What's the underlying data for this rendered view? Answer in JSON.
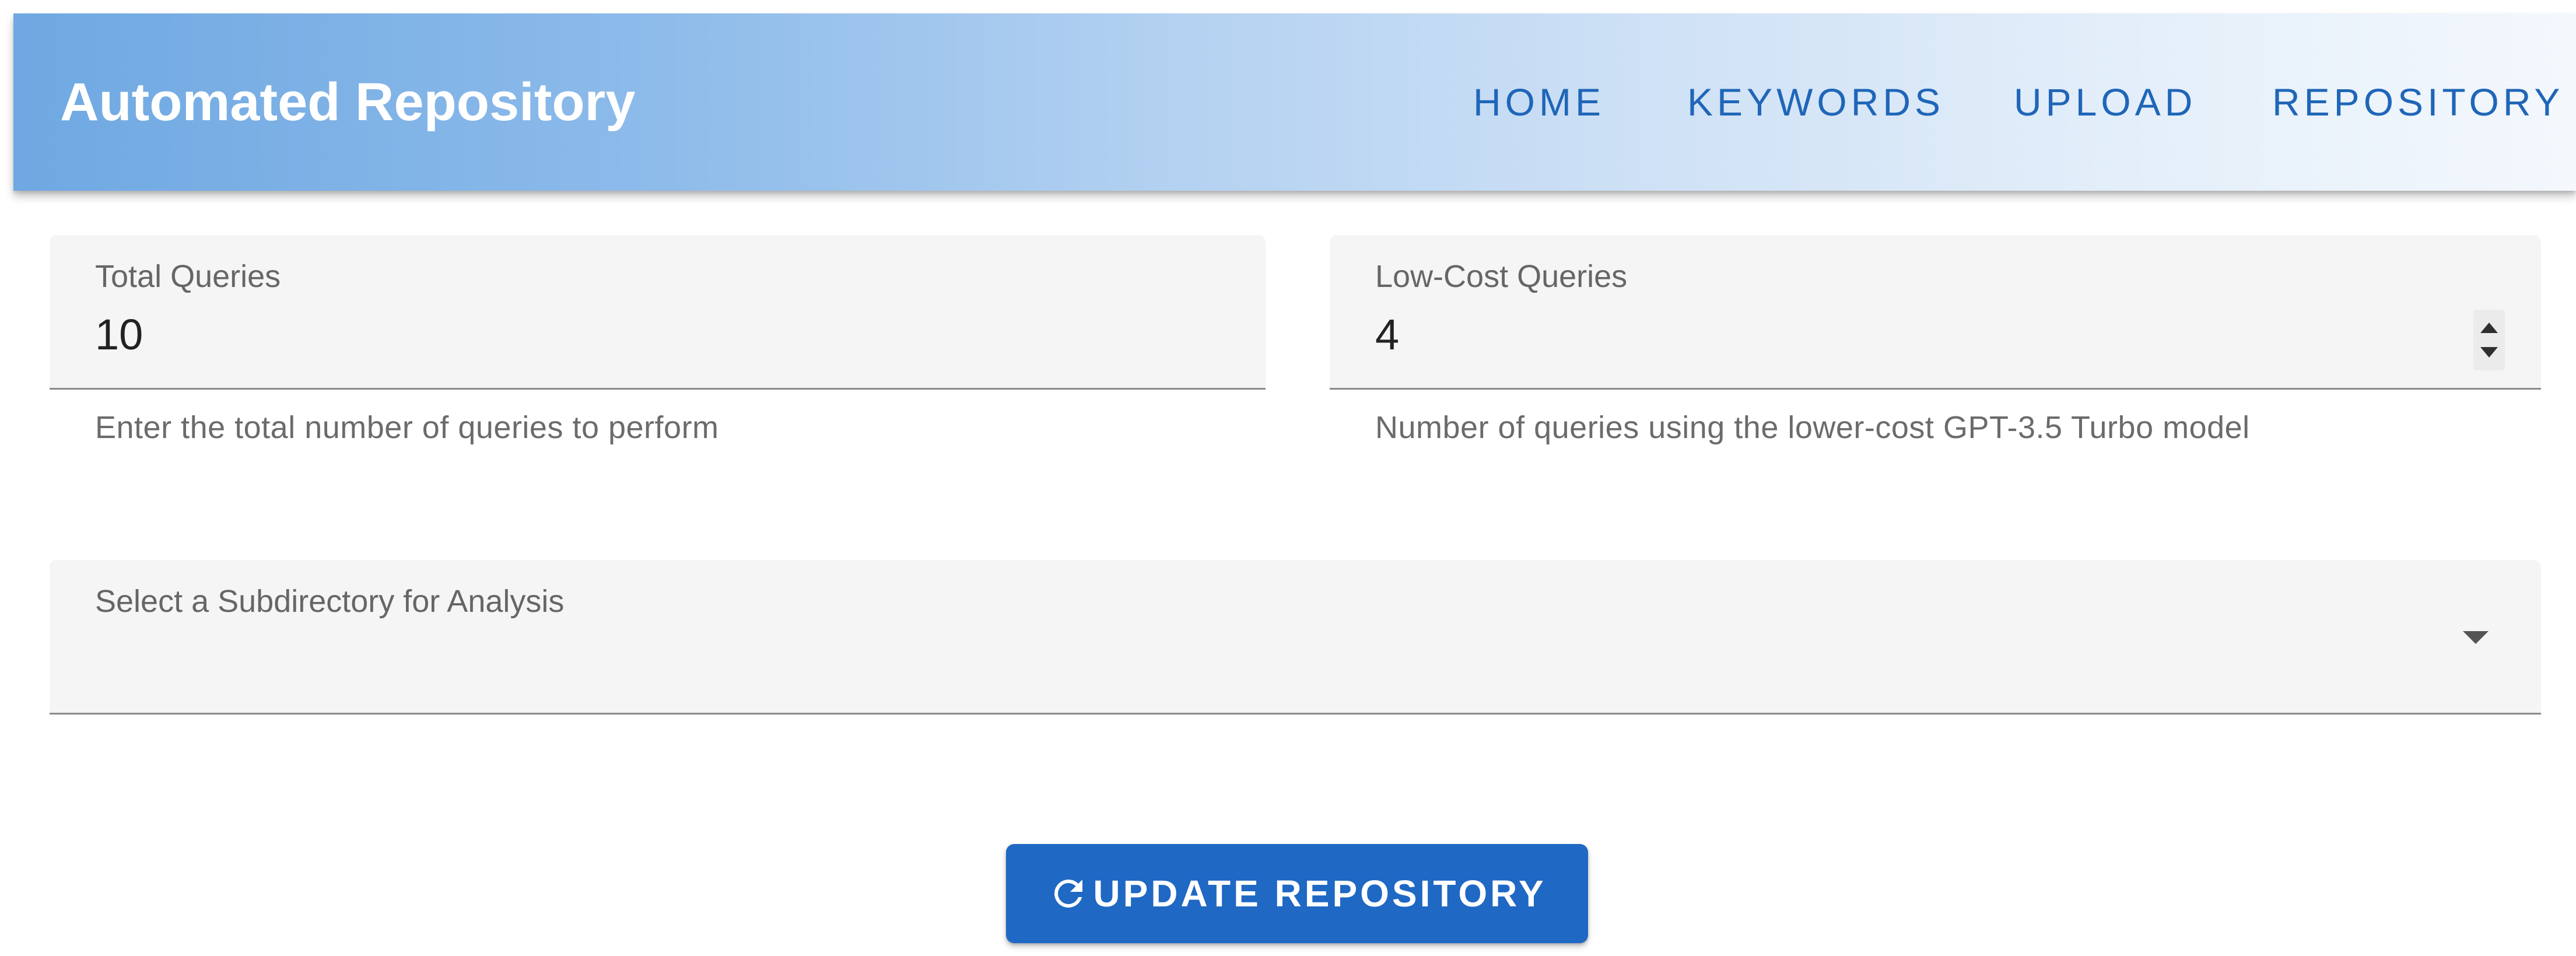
{
  "header": {
    "brand": "Automated Repository",
    "nav": [
      {
        "label": "HOME"
      },
      {
        "label": "KEYWORDS"
      },
      {
        "label": "UPLOAD"
      },
      {
        "label": "REPOSITORY"
      }
    ],
    "gradient_colors": [
      "#6fa8e2",
      "#f4f8fd"
    ],
    "nav_color": "#1f66b8"
  },
  "form": {
    "total_queries": {
      "label": "Total Queries",
      "value": "10",
      "helper": "Enter the total number of queries to perform"
    },
    "low_cost_queries": {
      "label": "Low-Cost Queries",
      "value": "4",
      "helper": "Number of queries using the lower-cost GPT-3.5 Turbo model",
      "spinner_icons": [
        "arrow-up-icon",
        "arrow-down-icon"
      ]
    },
    "subdirectory": {
      "label": "Select a Subdirectory for Analysis",
      "selected_value": "",
      "icon": "chevron-down-icon"
    }
  },
  "actions": {
    "update_button": {
      "label": "UPDATE REPOSITORY",
      "icon": "refresh-icon",
      "color": "#1f68c4"
    }
  }
}
